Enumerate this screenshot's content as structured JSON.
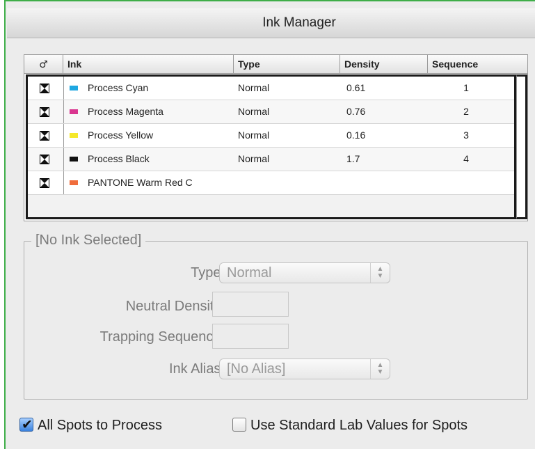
{
  "window": {
    "title": "Ink Manager"
  },
  "table": {
    "headers": {
      "icon_col": "♂",
      "ink": "Ink",
      "type": "Type",
      "density": "Density",
      "sequence": "Sequence"
    },
    "rows": [
      {
        "ink": "Process Cyan",
        "swatch": "#1ea7e1",
        "type": "Normal",
        "density": "0.61",
        "sequence": "1"
      },
      {
        "ink": "Process Magenta",
        "swatch": "#d9358f",
        "type": "Normal",
        "density": "0.76",
        "sequence": "2"
      },
      {
        "ink": "Process Yellow",
        "swatch": "#f5e82a",
        "type": "Normal",
        "density": "0.16",
        "sequence": "3"
      },
      {
        "ink": "Process Black",
        "swatch": "#111111",
        "type": "Normal",
        "density": "1.7",
        "sequence": "4"
      },
      {
        "ink": "PANTONE Warm Red C",
        "swatch": "#f06d3c",
        "type": "",
        "density": "",
        "sequence": ""
      }
    ]
  },
  "selection": {
    "group_title": "[No Ink Selected]",
    "type_label": "Type:",
    "type_value": "Normal",
    "neutral_density_label": "Neutral Density:",
    "trapping_sequence_label": "Trapping Sequence:",
    "ink_alias_label": "Ink Alias:",
    "ink_alias_value": "[No Alias]"
  },
  "options": {
    "all_spots_to_process": {
      "label": "All Spots to Process",
      "checked": true
    },
    "use_standard_lab": {
      "label": "Use Standard Lab Values for Spots",
      "checked": false
    }
  },
  "colors": {
    "frame_accent": "#3fae49"
  }
}
